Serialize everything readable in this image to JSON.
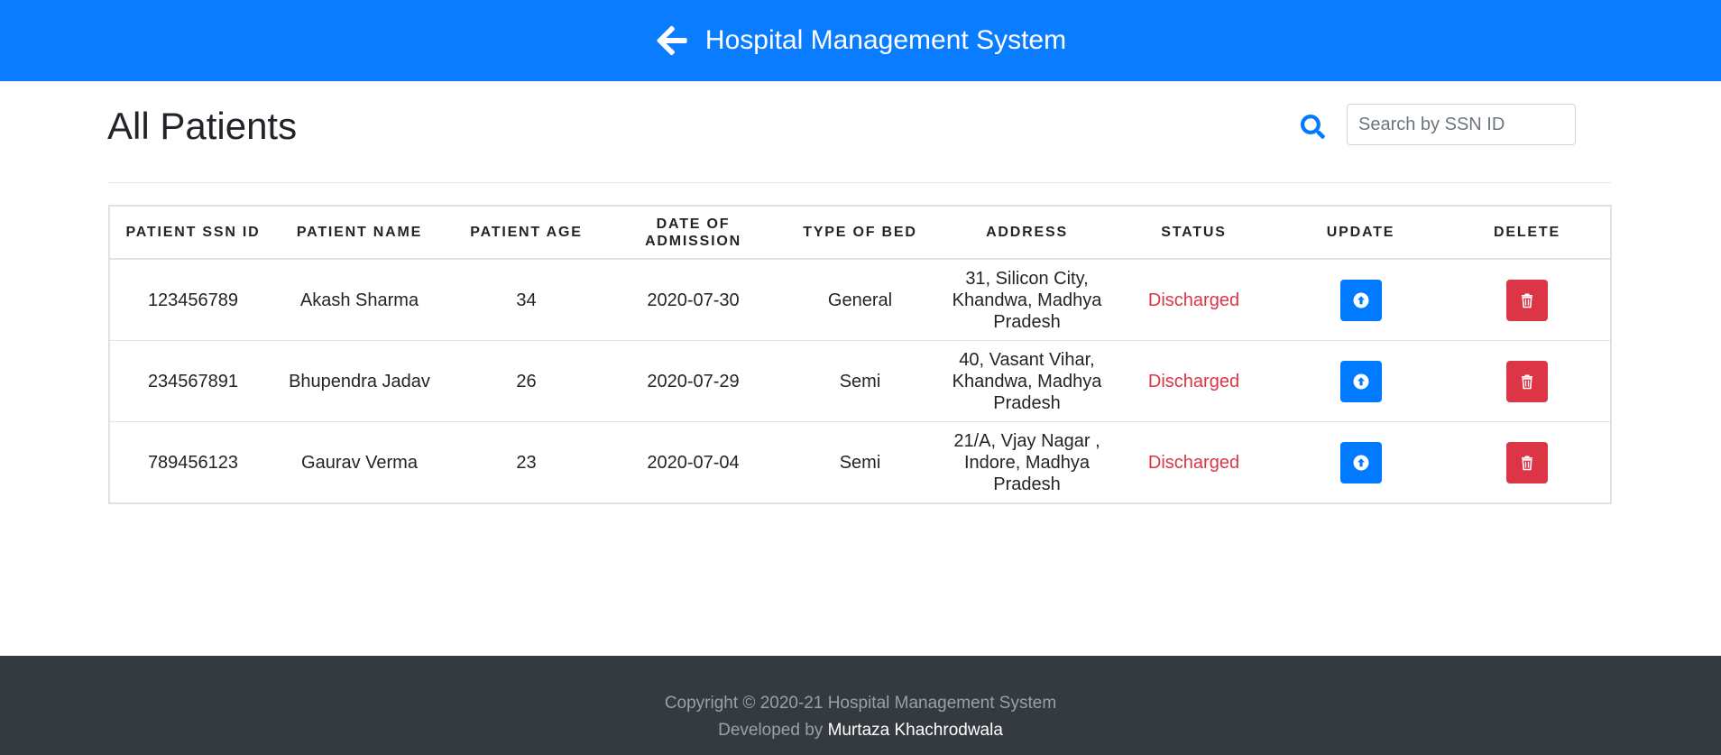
{
  "header": {
    "title": "Hospital Management System",
    "back_icon": "arrow-left-icon",
    "color": "#0a7cff"
  },
  "page": {
    "title": "All Patients"
  },
  "search": {
    "icon": "search-icon",
    "placeholder": "Search by SSN ID",
    "value": ""
  },
  "table": {
    "columns": [
      "PATIENT SSN ID",
      "PATIENT NAME",
      "PATIENT AGE",
      "DATE OF ADMISSION",
      "TYPE OF BED",
      "ADDRESS",
      "STATUS",
      "UPDATE",
      "DELETE"
    ],
    "rows": [
      {
        "ssn": "123456789",
        "name": "Akash Sharma",
        "age": "34",
        "doa": "2020-07-30",
        "bed": "General",
        "address": "31, Silicon City, Khandwa, Madhya Pradesh",
        "status": "Discharged"
      },
      {
        "ssn": "234567891",
        "name": "Bhupendra Jadav",
        "age": "26",
        "doa": "2020-07-29",
        "bed": "Semi",
        "address": "40, Vasant Vihar, Khandwa, Madhya Pradesh",
        "status": "Discharged"
      },
      {
        "ssn": "789456123",
        "name": "Gaurav Verma",
        "age": "23",
        "doa": "2020-07-04",
        "bed": "Semi",
        "address": "21/A, Vjay Nagar , Indore, Madhya Pradesh",
        "status": "Discharged"
      }
    ],
    "update_icon": "arrow-circle-up-icon",
    "delete_icon": "trash-icon",
    "status_color": "#dc3545",
    "update_color": "#007bff",
    "delete_color": "#dc3545"
  },
  "footer": {
    "copyright": "Copyright © 2020-21 Hospital Management System",
    "developed_by_prefix": "Developed by",
    "developer_name": "Murtaza Khachrodwala",
    "color": "#343a40"
  }
}
